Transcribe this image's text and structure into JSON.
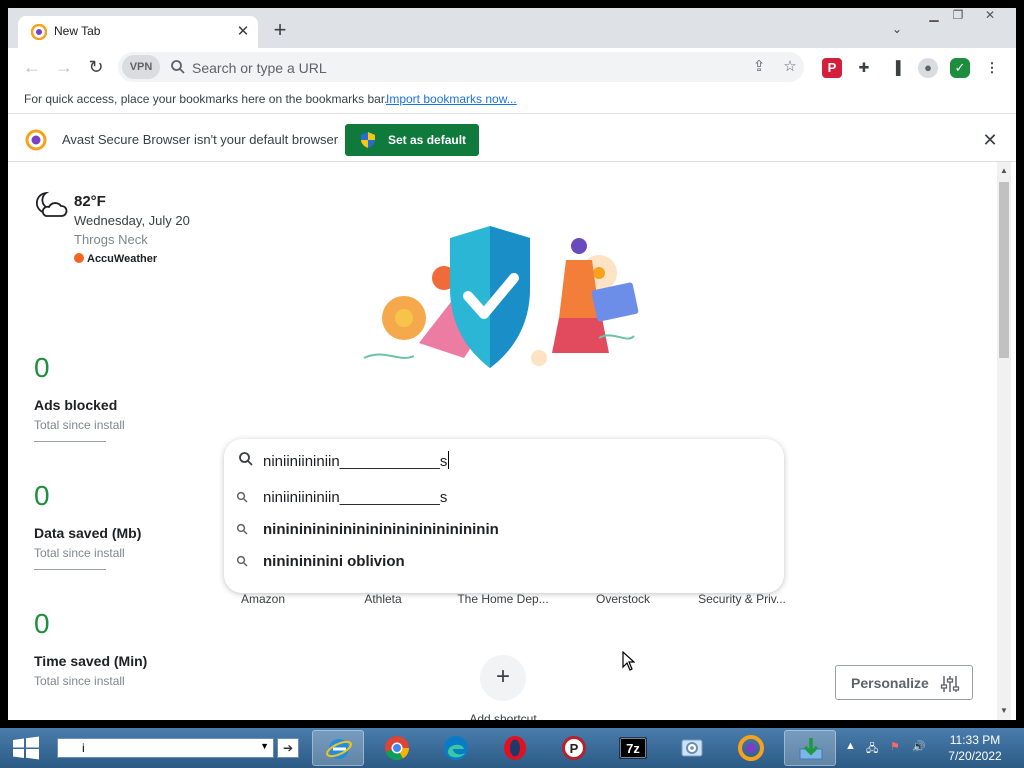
{
  "browser": {
    "tab": {
      "title": "New Tab"
    },
    "omnibox": {
      "placeholder": "Search or type a URL",
      "vpn_label": "VPN"
    },
    "bookmarks_bar": {
      "message": "For quick access, place your bookmarks here on the bookmarks bar.",
      "import_link": "Import bookmarks now..."
    },
    "infobar": {
      "message": "Avast Secure Browser isn't your default browser",
      "button_label": "Set as default"
    }
  },
  "weather": {
    "temperature": "82°F",
    "date": "Wednesday, July 20",
    "location": "Throgs Neck",
    "provider": "AccuWeather"
  },
  "stats": [
    {
      "value": "0",
      "label": "Ads blocked",
      "sub": "Total since install"
    },
    {
      "value": "0",
      "label": "Data saved (Mb)",
      "sub": "Total since install"
    },
    {
      "value": "0",
      "label": "Time saved (Min)",
      "sub": "Total since install"
    }
  ],
  "search": {
    "query": "niniiniininiin____________s",
    "suggestions": [
      "niniiniininiin____________s",
      "nininininininininininininininininin",
      "nininininini oblivion"
    ]
  },
  "shortcuts": [
    "Amazon",
    "Athleta",
    "The Home Dep...",
    "Overstock",
    "Security & Priv..."
  ],
  "add_shortcut_label": "Add shortcut",
  "personalize_label": "Personalize",
  "taskbar": {
    "search_value": "i",
    "clock_time": "11:33 PM",
    "clock_date": "7/20/2022",
    "apps": [
      "internet-explorer",
      "chrome",
      "edge",
      "opera",
      "pdf-reader",
      "7zip",
      "control-panel",
      "avast-browser",
      "downloads"
    ]
  },
  "colors": {
    "accent_green": "#0f7a3b",
    "stat_green": "#1e8e3e",
    "link_blue": "#1a73e8",
    "taskbar_blue": "#2b5a85"
  }
}
